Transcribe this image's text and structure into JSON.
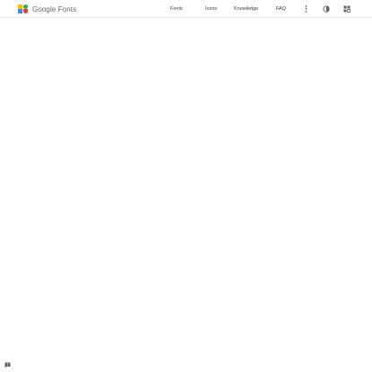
{
  "header": {
    "brand": "Google Fonts",
    "nav": {
      "fonts": "Fonts",
      "icons": "Icons",
      "knowledge": "Knowledge",
      "faq": "FAQ"
    },
    "icons": {
      "more": "more-vert-icon",
      "theme": "theme-toggle-icon",
      "apps": "font-selection-icon"
    }
  },
  "feedback": {
    "icon": "feedback-icon"
  },
  "colors": {
    "logo_yellow": "#fbbc04",
    "logo_green": "#34a853",
    "logo_blue": "#4285f4",
    "logo_red": "#ea4335"
  }
}
